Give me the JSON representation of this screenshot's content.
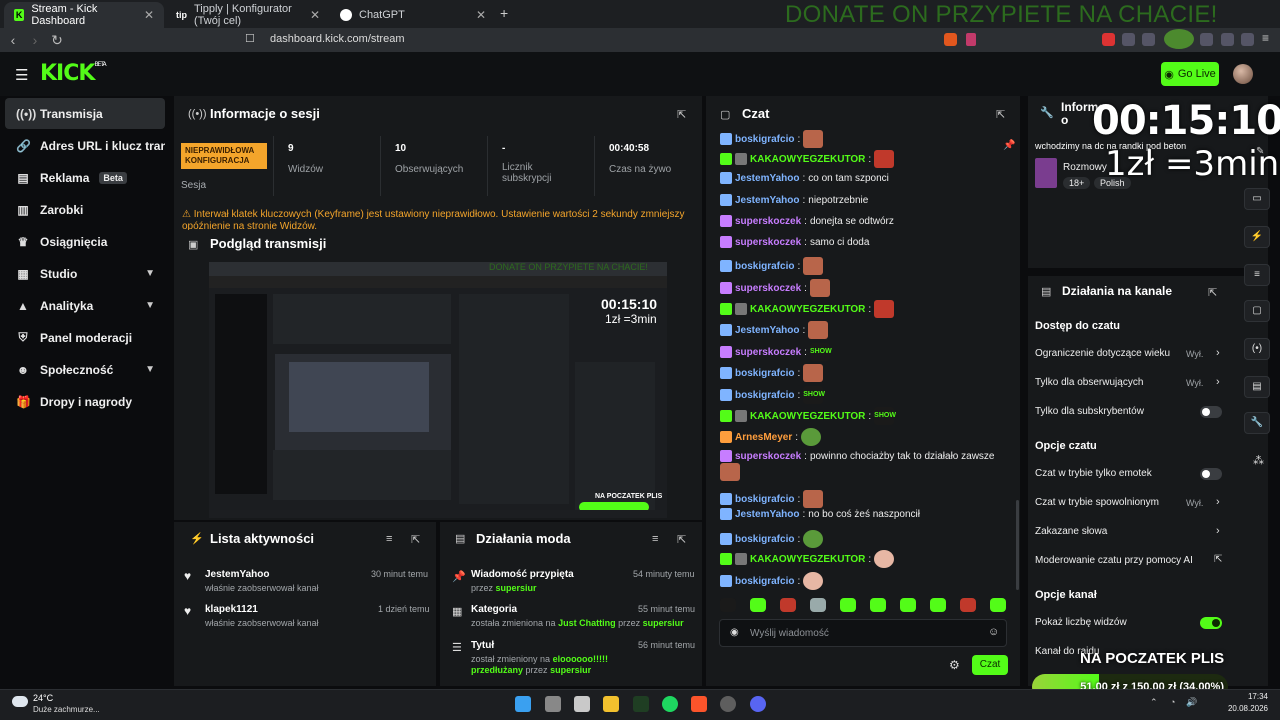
{
  "browser": {
    "tabs": [
      {
        "label": "Stream - Kick Dashboard",
        "icon": "K"
      },
      {
        "label": "Tipply | Konfigurator (Twój cel)",
        "icon": "tip"
      },
      {
        "label": "ChatGPT",
        "icon": "chatgpt-icon"
      }
    ],
    "new_tab": "+",
    "url": "dashboard.kick.com/stream",
    "overlay_banner": "DONATE ON PRZYPIETE NA CHACIE!"
  },
  "header": {
    "logo": "KICK",
    "logo_sup": "BETA",
    "go_live": "Go Live"
  },
  "sidebar": {
    "items": [
      {
        "label": "Transmisja",
        "icon": "broadcast-icon",
        "active": true
      },
      {
        "label": "Adres URL i klucz transmisji",
        "icon": "link-icon"
      },
      {
        "label": "Reklama",
        "icon": "ad-icon",
        "badge": "Beta"
      },
      {
        "label": "Zarobki",
        "icon": "earnings-icon"
      },
      {
        "label": "Osiągnięcia",
        "icon": "trophy-icon"
      },
      {
        "label": "Studio",
        "icon": "studio-icon",
        "chevron": true
      },
      {
        "label": "Analityka",
        "icon": "analytics-icon",
        "chevron": true
      },
      {
        "label": "Panel moderacji",
        "icon": "shield-icon"
      },
      {
        "label": "Społeczność",
        "icon": "community-icon",
        "chevron": true
      },
      {
        "label": "Dropy i nagrody",
        "icon": "gift-icon"
      }
    ]
  },
  "session": {
    "title": "Informacje o sesji",
    "status_badge": "NIEPRAWIDŁOWA KONFIGURACJA",
    "status_label": "Sesja",
    "stats": [
      {
        "value": "9",
        "label": "Widzów"
      },
      {
        "value": "10",
        "label": "Obserwujących"
      },
      {
        "value": "-",
        "label": "Licznik subskrypcji"
      },
      {
        "value": "00:40:58",
        "label": "Czas na żywo"
      }
    ],
    "warning": "Interwał klatek kluczowych (Keyframe) jest ustawiony nieprawidłowo. Ustawienie wartości 2 sekundy zmniejszy opóźnienie na stronie Widzów."
  },
  "preview": {
    "title": "Podgląd transmisji",
    "mini_timer": "00:15:10",
    "mini_rate": "1zł =3min",
    "mini_goal": "NA POCZATEK PLIS"
  },
  "activity": {
    "title": "Lista aktywności",
    "items": [
      {
        "name": "JestemYahoo",
        "action": "właśnie zaobserwował kanał",
        "time": "30 minut temu"
      },
      {
        "name": "klapek1121",
        "action": "właśnie zaobserwował kanał",
        "time": "1 dzień temu"
      }
    ]
  },
  "modactions": {
    "title": "Działania moda",
    "items": [
      {
        "title": "Wiadomość przypięta",
        "sub_pre": "przez",
        "sub_user": "supersiur",
        "time": "54 minuty temu"
      },
      {
        "title": "Kategoria",
        "sub_pre": "została zmieniona na",
        "sub_cat": "Just Chatting",
        "sub_mid": "przez",
        "sub_user": "supersiur",
        "time": "55 minut temu"
      },
      {
        "title": "Tytuł",
        "sub_pre": "został zmieniony na",
        "sub_cat": "eloooooo!!!!! przedłużany",
        "sub_mid": "przez",
        "sub_user": "supersiur",
        "time": "56 minut temu"
      }
    ]
  },
  "chat": {
    "title": "Czat",
    "input_placeholder": "Wyślij wiadomość",
    "send_label": "Czat",
    "messages": [
      {
        "user": "boskigrafcio",
        "text": "",
        "color": "#7fb4ff",
        "emote": "face"
      },
      {
        "user": "KAKAOWYEGZEKUTOR",
        "text": "",
        "color": "#53fc18",
        "emote": "angry"
      },
      {
        "user": "JestemYahoo",
        "text": "co on tam szponci",
        "color": "#7fb4ff"
      },
      {
        "user": "JestemYahoo",
        "text": "niepotrzebnie",
        "color": "#7fb4ff"
      },
      {
        "user": "superskoczek",
        "text": "donejta se odtwórz",
        "color": "#c77dff"
      },
      {
        "user": "superskoczek",
        "text": "samo ci doda",
        "color": "#c77dff"
      },
      {
        "user": "boskigrafcio",
        "text": "",
        "color": "#7fb4ff",
        "emote": "face"
      },
      {
        "user": "superskoczek",
        "text": "",
        "color": "#c77dff",
        "emote": "face"
      },
      {
        "user": "KAKAOWYEGZEKUTOR",
        "text": "",
        "color": "#53fc18",
        "emote": "angry"
      },
      {
        "user": "JestemYahoo",
        "text": "",
        "color": "#7fb4ff",
        "emote": "face"
      },
      {
        "user": "superskoczek",
        "text": "",
        "color": "#c77dff",
        "emote": "show"
      },
      {
        "user": "boskigrafcio",
        "text": "",
        "color": "#7fb4ff",
        "emote": "face"
      },
      {
        "user": "boskigrafcio",
        "text": "",
        "color": "#7fb4ff",
        "emote": "show"
      },
      {
        "user": "KAKAOWYEGZEKUTOR",
        "text": "",
        "color": "#53fc18",
        "emote": "show"
      },
      {
        "user": "ArnesMeyer",
        "text": "",
        "color": "#ff9e3d",
        "emote": "pepe"
      },
      {
        "user": "superskoczek",
        "text": "powinno chociażby tak to działało zawsze",
        "color": "#c77dff"
      },
      {
        "user": "boskigrafcio",
        "text": "",
        "color": "#7fb4ff",
        "emote": "face"
      },
      {
        "user": "JestemYahoo",
        "text": "no bo coś żeś naszponcił",
        "color": "#7fb4ff"
      },
      {
        "user": "boskigrafcio",
        "text": "",
        "color": "#7fb4ff",
        "emote": "pepe"
      },
      {
        "user": "KAKAOWYEGZEKUTOR",
        "text": "",
        "color": "#53fc18",
        "emote": "round"
      },
      {
        "user": "boskigrafcio",
        "text": "",
        "color": "#7fb4ff",
        "emote": "round"
      }
    ]
  },
  "stream_info": {
    "title": "Informacje o transmisji",
    "stream_title": "wchodzimy na dc na randki pod beton",
    "category": "Rozmowy",
    "tags": [
      "18+",
      "Polish"
    ]
  },
  "overlay": {
    "timer": "00:15:10",
    "rate": "1zł =3min",
    "goal_title": "NA POCZATEK PLIS",
    "goal_label": "51,00 zł z 150,00 zł (34.00%)",
    "goal_fraction": 0.34
  },
  "channel_actions": {
    "title": "Działania na kanale",
    "sections": [
      {
        "heading": "Dostęp do czatu",
        "opts": [
          {
            "label": "Ograniczenie dotyczące wieku",
            "value": "Wył.",
            "kind": "chevron"
          },
          {
            "label": "Tylko dla obserwujących",
            "value": "Wył.",
            "kind": "chevron"
          },
          {
            "label": "Tylko dla subskrybentów",
            "kind": "toggle",
            "on": false
          }
        ]
      },
      {
        "heading": "Opcje czatu",
        "opts": [
          {
            "label": "Czat w trybie tylko emotek",
            "kind": "toggle",
            "on": false
          },
          {
            "label": "Czat w trybie spowolnionym",
            "value": "Wył.",
            "kind": "chevron"
          },
          {
            "label": "Zakazane słowa",
            "kind": "chevron"
          },
          {
            "label": "Moderowanie czatu przy pomocy AI",
            "kind": "external"
          }
        ]
      },
      {
        "heading": "Opcje kanał",
        "opts": [
          {
            "label": "Pokaż liczbę widzów",
            "kind": "toggle",
            "on": true
          },
          {
            "label": "Kanał do raidu",
            "kind": "none"
          }
        ]
      }
    ]
  },
  "taskbar": {
    "weather_temp": "24°C",
    "weather_desc": "Duże zachmurze...",
    "time": "17:34",
    "date": "20.08.2026"
  }
}
